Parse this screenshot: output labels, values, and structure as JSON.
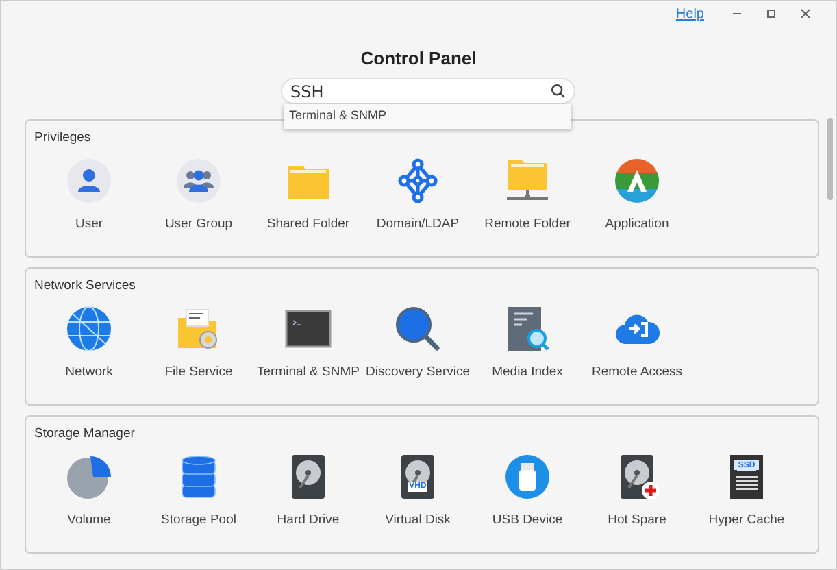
{
  "window": {
    "help": "Help"
  },
  "title": "Control Panel",
  "search": {
    "value": "SSH",
    "suggestions": [
      "Terminal & SNMP"
    ]
  },
  "sections": [
    {
      "title": "Privileges",
      "items": [
        {
          "label": "User",
          "kind": "user"
        },
        {
          "label": "User Group",
          "kind": "group"
        },
        {
          "label": "Shared Folder",
          "kind": "folder"
        },
        {
          "label": "Domain/LDAP",
          "kind": "domain"
        },
        {
          "label": "Remote Folder",
          "kind": "remote-folder"
        },
        {
          "label": "Application",
          "kind": "app"
        }
      ]
    },
    {
      "title": "Network Services",
      "items": [
        {
          "label": "Network",
          "kind": "globe"
        },
        {
          "label": "File Service",
          "kind": "file-service"
        },
        {
          "label": "Terminal & SNMP",
          "kind": "terminal"
        },
        {
          "label": "Discovery Service",
          "kind": "discovery"
        },
        {
          "label": "Media Index",
          "kind": "media-index"
        },
        {
          "label": "Remote Access",
          "kind": "cloud"
        }
      ]
    },
    {
      "title": "Storage Manager",
      "items": [
        {
          "label": "Volume",
          "kind": "volume"
        },
        {
          "label": "Storage Pool",
          "kind": "pool"
        },
        {
          "label": "Hard Drive",
          "kind": "disk"
        },
        {
          "label": "Virtual Disk",
          "kind": "vdisk",
          "badge": "VHD"
        },
        {
          "label": "USB Device",
          "kind": "usb"
        },
        {
          "label": "Hot Spare",
          "kind": "hot-spare"
        },
        {
          "label": "Hyper Cache",
          "kind": "ssd",
          "badge": "SSD"
        }
      ]
    }
  ]
}
